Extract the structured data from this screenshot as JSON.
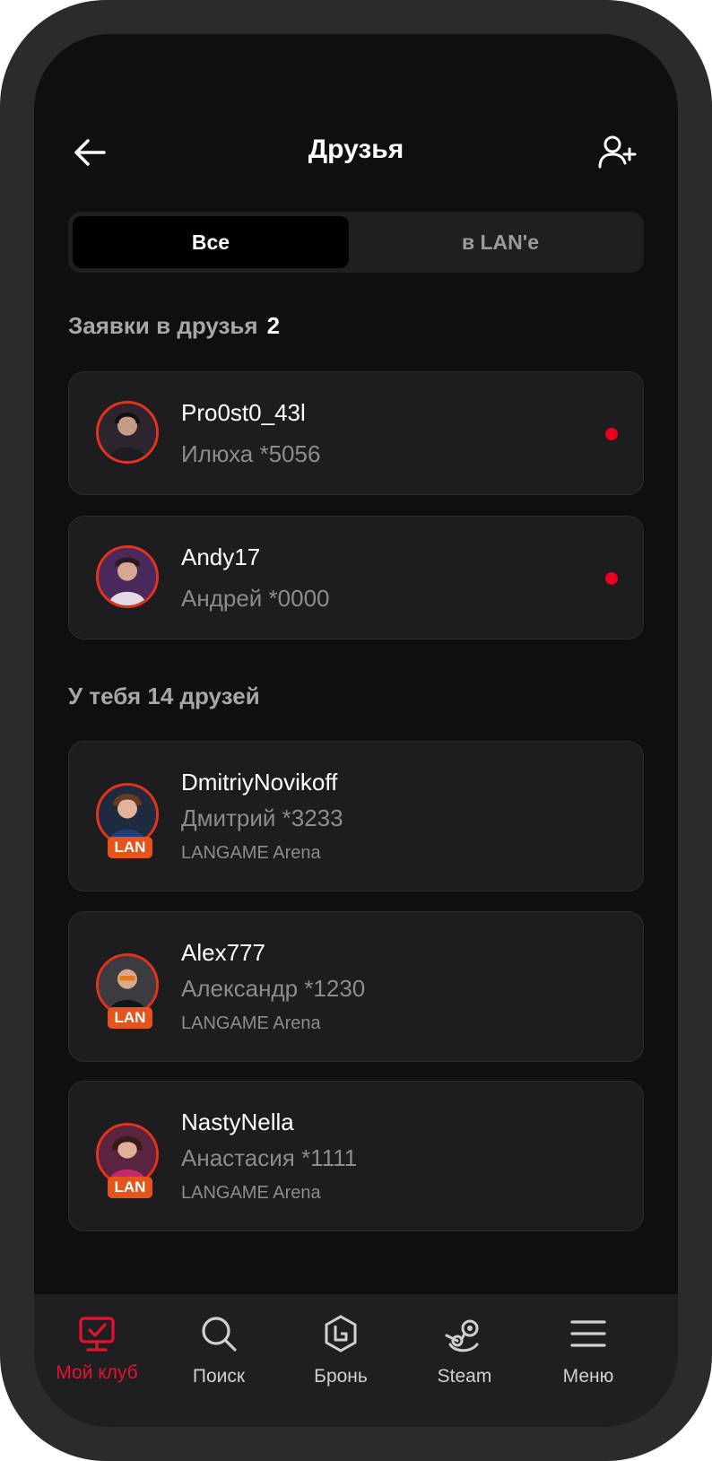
{
  "header": {
    "title": "Друзья"
  },
  "tabs": [
    {
      "label": "Все",
      "active": true
    },
    {
      "label": "в LAN'e",
      "active": false
    }
  ],
  "requests": {
    "title": "Заявки в друзья",
    "count": "2",
    "items": [
      {
        "nick": "Pro0st0_43l",
        "name": "Илюха *5056"
      },
      {
        "nick": "Andy17",
        "name": "Андрей *0000"
      }
    ]
  },
  "friends": {
    "title": "У тебя 14 друзей",
    "items": [
      {
        "nick": "DmitriyNovikoff",
        "name": "Дмитрий *3233",
        "club": "LANGAME Arena",
        "badge": "LAN"
      },
      {
        "nick": "Alex777",
        "name": "Александр *1230",
        "club": "LANGAME Arena",
        "badge": "LAN"
      },
      {
        "nick": "NastyNella",
        "name": "Анастасия *1111",
        "club": "LANGAME Arena",
        "badge": "LAN"
      }
    ]
  },
  "nav": {
    "items": [
      {
        "label": "Мой клуб",
        "icon": "monitor-check-icon",
        "active": true
      },
      {
        "label": "Поиск",
        "icon": "search-icon",
        "active": false
      },
      {
        "label": "Бронь",
        "icon": "langame-logo-icon",
        "active": false
      },
      {
        "label": "Steam",
        "icon": "steam-icon",
        "active": false
      },
      {
        "label": "Меню",
        "icon": "hamburger-menu-icon",
        "active": false
      }
    ]
  },
  "colors": {
    "accent": "#e8112d",
    "notification_dot": "#e8001c",
    "lan_badge": "#e4541b"
  }
}
